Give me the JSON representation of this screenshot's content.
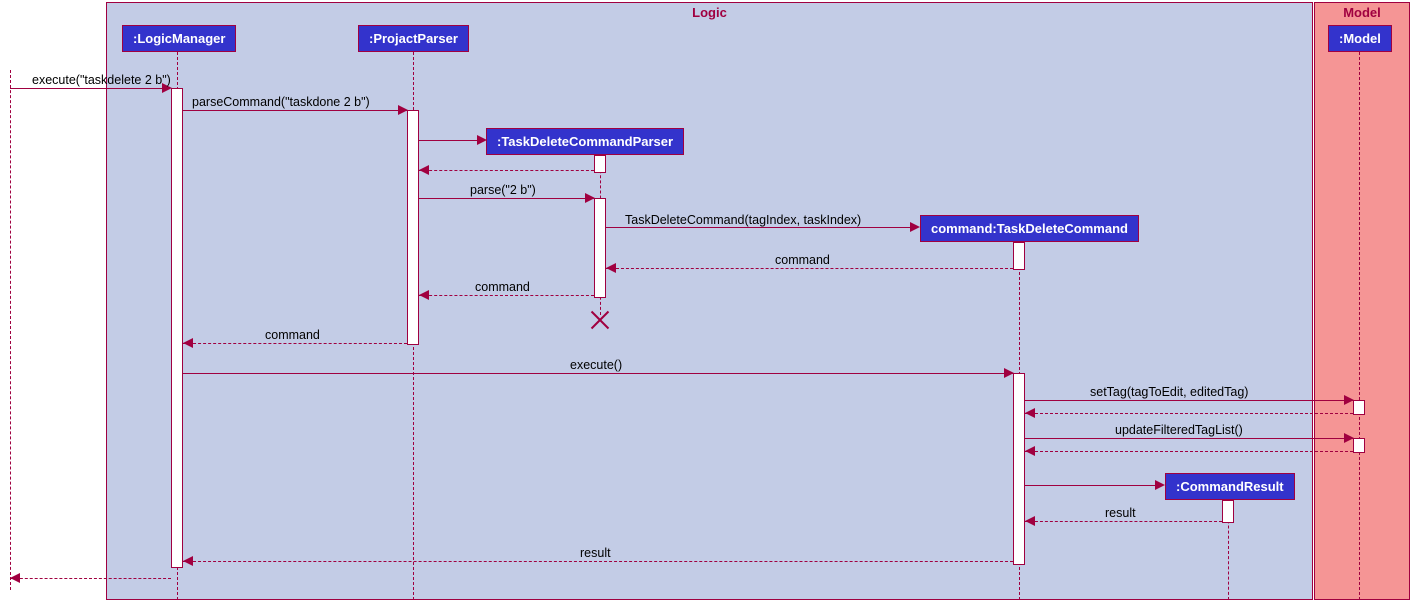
{
  "boxes": {
    "logic": "Logic",
    "model": "Model"
  },
  "participants": {
    "logicManager": ":LogicManager",
    "projactParser": ":ProjactParser",
    "taskDeleteCommandParser": ":TaskDeleteCommandParser",
    "taskDeleteCommand": "command:TaskDeleteCommand",
    "commandResult": ":CommandResult",
    "model": ":Model"
  },
  "messages": {
    "m1": "execute(\"taskdelete 2 b\")",
    "m2": "parseCommand(\"taskdone 2 b\")",
    "m3": "parse(\"2 b\")",
    "m4": "TaskDeleteCommand(tagIndex, taskIndex)",
    "m5": "command",
    "m6": "command",
    "m7": "command",
    "m8": "execute()",
    "m9": "setTag(tagToEdit, editedTag)",
    "m10": "updateFilteredTagList()",
    "m11": "result",
    "m12": "result"
  }
}
